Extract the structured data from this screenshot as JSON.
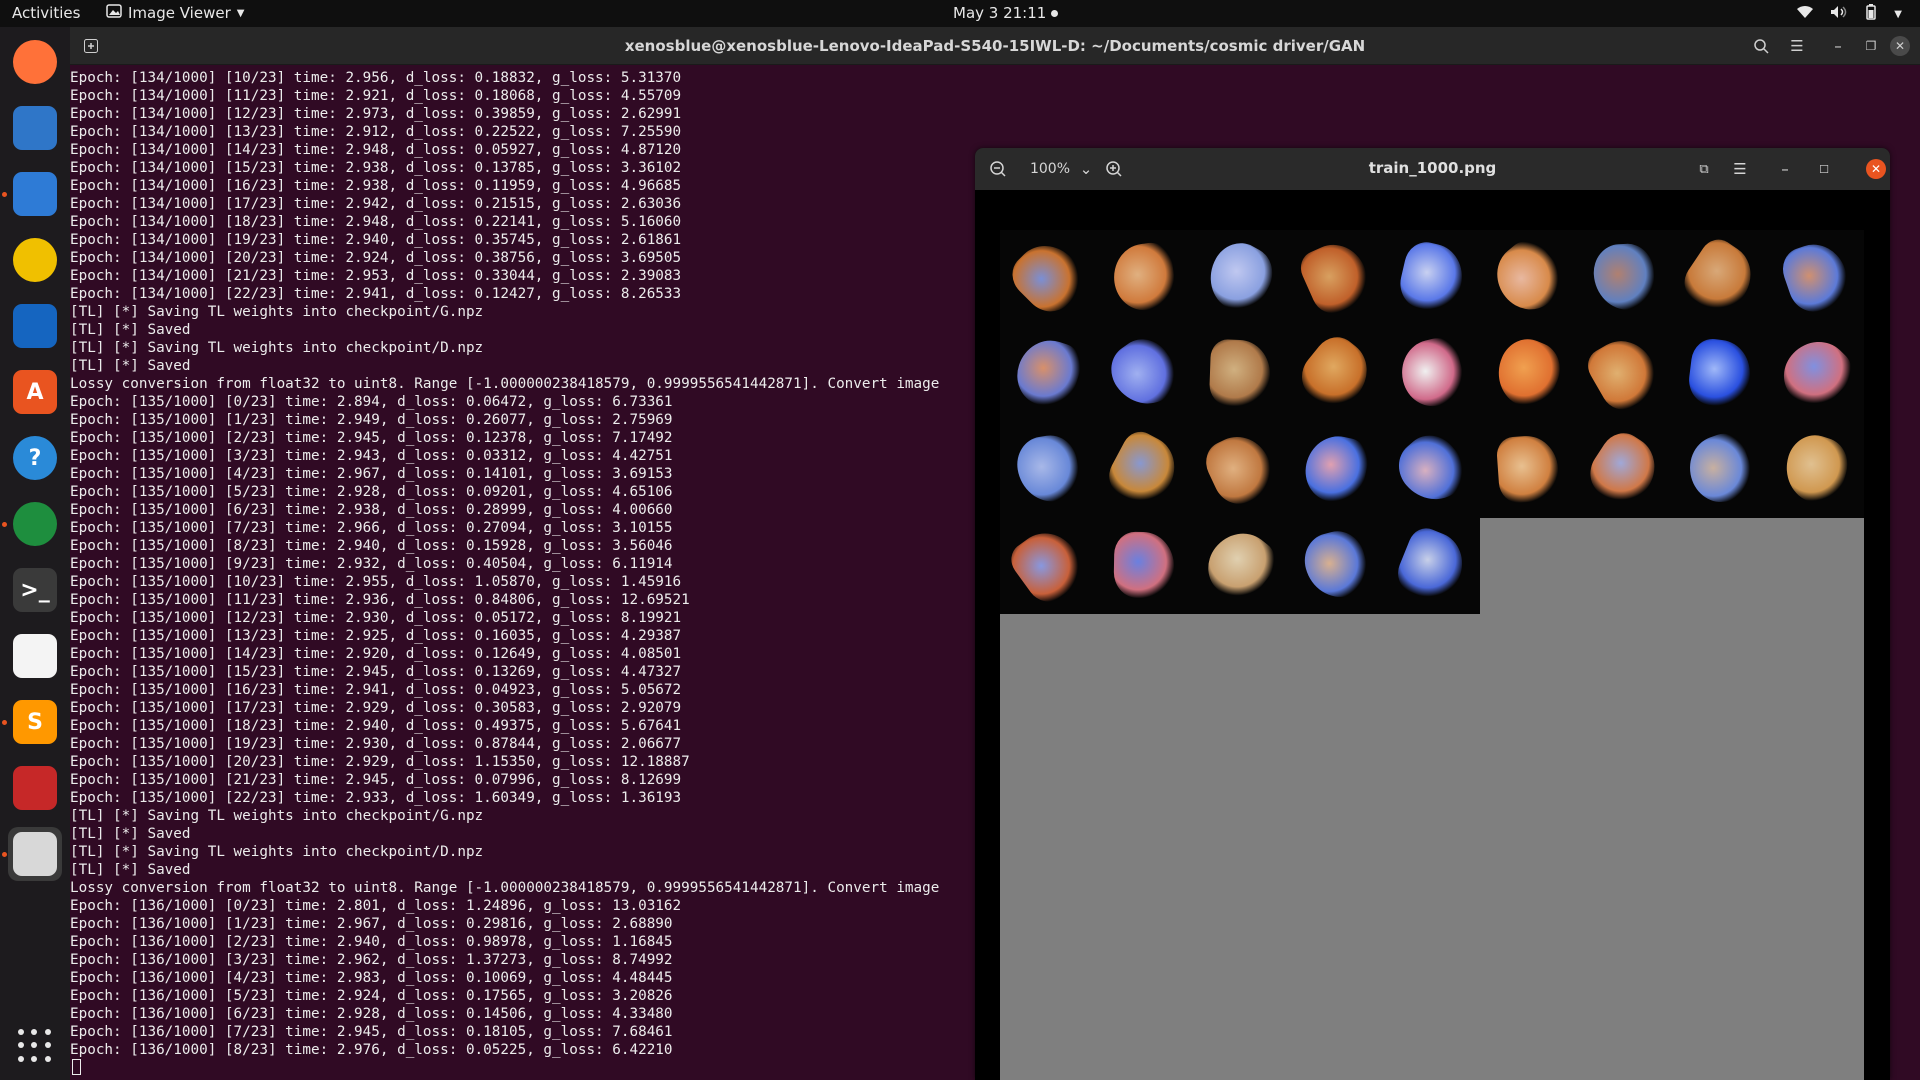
{
  "topbar": {
    "activities": "Activities",
    "app_name": "Image Viewer",
    "clock": "May 3  21:11"
  },
  "dock": {
    "items": [
      {
        "name": "firefox-icon",
        "glyph": "",
        "color": "#ff7139"
      },
      {
        "name": "thunderbird-icon",
        "glyph": "",
        "color": "#2f76c8"
      },
      {
        "name": "files-icon",
        "glyph": "",
        "color": "#2e7bd6"
      },
      {
        "name": "rhythmbox-icon",
        "glyph": "",
        "color": "#f0c000"
      },
      {
        "name": "writer-icon",
        "glyph": "",
        "color": "#1565c0"
      },
      {
        "name": "software-icon",
        "glyph": "A",
        "color": "#e95420"
      },
      {
        "name": "help-icon",
        "glyph": "?",
        "color": "#2a8ad8"
      },
      {
        "name": "chrome-icon",
        "glyph": "",
        "color": "#1e8e3e"
      },
      {
        "name": "terminal-icon",
        "glyph": ">_",
        "color": "#3a3a3a"
      },
      {
        "name": "text-editor-icon",
        "glyph": "",
        "color": "#f4f4f4"
      },
      {
        "name": "sublime-icon",
        "glyph": "S",
        "color": "#ff9800"
      },
      {
        "name": "mosaic-app-icon",
        "glyph": "",
        "color": "#c62828"
      },
      {
        "name": "image-viewer-icon",
        "glyph": "",
        "color": "#d8d8d8"
      }
    ],
    "apps_grid": "show-applications"
  },
  "terminal": {
    "title": "xenosblue@xenosblue-Lenovo-IdeaPad-S540-15IWL-D: ~/Documents/cosmic driver/GAN",
    "lines": [
      "Epoch: [134/1000] [10/23] time: 2.956, d_loss: 0.18832, g_loss: 5.31370",
      "Epoch: [134/1000] [11/23] time: 2.921, d_loss: 0.18068, g_loss: 4.55709",
      "Epoch: [134/1000] [12/23] time: 2.973, d_loss: 0.39859, g_loss: 2.62991",
      "Epoch: [134/1000] [13/23] time: 2.912, d_loss: 0.22522, g_loss: 7.25590",
      "Epoch: [134/1000] [14/23] time: 2.948, d_loss: 0.05927, g_loss: 4.87120",
      "Epoch: [134/1000] [15/23] time: 2.938, d_loss: 0.13785, g_loss: 3.36102",
      "Epoch: [134/1000] [16/23] time: 2.938, d_loss: 0.11959, g_loss: 4.96685",
      "Epoch: [134/1000] [17/23] time: 2.942, d_loss: 0.21515, g_loss: 2.63036",
      "Epoch: [134/1000] [18/23] time: 2.948, d_loss: 0.22141, g_loss: 5.16060",
      "Epoch: [134/1000] [19/23] time: 2.940, d_loss: 0.35745, g_loss: 2.61861",
      "Epoch: [134/1000] [20/23] time: 2.924, d_loss: 0.38756, g_loss: 3.69505",
      "Epoch: [134/1000] [21/23] time: 2.953, d_loss: 0.33044, g_loss: 2.39083",
      "Epoch: [134/1000] [22/23] time: 2.941, d_loss: 0.12427, g_loss: 8.26533",
      "[TL] [*] Saving TL weights into checkpoint/G.npz",
      "[TL] [*] Saved",
      "[TL] [*] Saving TL weights into checkpoint/D.npz",
      "[TL] [*] Saved",
      "Lossy conversion from float32 to uint8. Range [-1.000000238418579, 0.9999556541442871]. Convert image",
      "Epoch: [135/1000] [0/23] time: 2.894, d_loss: 0.06472, g_loss: 6.73361",
      "Epoch: [135/1000] [1/23] time: 2.949, d_loss: 0.26077, g_loss: 2.75969",
      "Epoch: [135/1000] [2/23] time: 2.945, d_loss: 0.12378, g_loss: 7.17492",
      "Epoch: [135/1000] [3/23] time: 2.943, d_loss: 0.03312, g_loss: 4.42751",
      "Epoch: [135/1000] [4/23] time: 2.967, d_loss: 0.14101, g_loss: 3.69153",
      "Epoch: [135/1000] [5/23] time: 2.928, d_loss: 0.09201, g_loss: 4.65106",
      "Epoch: [135/1000] [6/23] time: 2.938, d_loss: 0.28999, g_loss: 4.00660",
      "Epoch: [135/1000] [7/23] time: 2.966, d_loss: 0.27094, g_loss: 3.10155",
      "Epoch: [135/1000] [8/23] time: 2.940, d_loss: 0.15928, g_loss: 3.56046",
      "Epoch: [135/1000] [9/23] time: 2.932, d_loss: 0.40504, g_loss: 6.11914",
      "Epoch: [135/1000] [10/23] time: 2.955, d_loss: 1.05870, g_loss: 1.45916",
      "Epoch: [135/1000] [11/23] time: 2.936, d_loss: 0.84806, g_loss: 12.69521",
      "Epoch: [135/1000] [12/23] time: 2.930, d_loss: 0.05172, g_loss: 8.19921",
      "Epoch: [135/1000] [13/23] time: 2.925, d_loss: 0.16035, g_loss: 4.29387",
      "Epoch: [135/1000] [14/23] time: 2.920, d_loss: 0.12649, g_loss: 4.08501",
      "Epoch: [135/1000] [15/23] time: 2.945, d_loss: 0.13269, g_loss: 4.47327",
      "Epoch: [135/1000] [16/23] time: 2.941, d_loss: 0.04923, g_loss: 5.05672",
      "Epoch: [135/1000] [17/23] time: 2.929, d_loss: 0.30583, g_loss: 2.92079",
      "Epoch: [135/1000] [18/23] time: 2.940, d_loss: 0.49375, g_loss: 5.67641",
      "Epoch: [135/1000] [19/23] time: 2.930, d_loss: 0.87844, g_loss: 2.06677",
      "Epoch: [135/1000] [20/23] time: 2.929, d_loss: 1.15350, g_loss: 12.18887",
      "Epoch: [135/1000] [21/23] time: 2.945, d_loss: 0.07996, g_loss: 8.12699",
      "Epoch: [135/1000] [22/23] time: 2.933, d_loss: 1.60349, g_loss: 1.36193",
      "[TL] [*] Saving TL weights into checkpoint/G.npz",
      "[TL] [*] Saved",
      "[TL] [*] Saving TL weights into checkpoint/D.npz",
      "[TL] [*] Saved",
      "Lossy conversion from float32 to uint8. Range [-1.000000238418579, 0.9999556541442871]. Convert image",
      "Epoch: [136/1000] [0/23] time: 2.801, d_loss: 1.24896, g_loss: 13.03162",
      "Epoch: [136/1000] [1/23] time: 2.967, d_loss: 0.29816, g_loss: 2.68890",
      "Epoch: [136/1000] [2/23] time: 2.940, d_loss: 0.98978, g_loss: 1.16845",
      "Epoch: [136/1000] [3/23] time: 2.962, d_loss: 1.37273, g_loss: 8.74992",
      "Epoch: [136/1000] [4/23] time: 2.983, d_loss: 0.10069, g_loss: 4.48445",
      "Epoch: [136/1000] [5/23] time: 2.924, d_loss: 0.17565, g_loss: 3.20826",
      "Epoch: [136/1000] [6/23] time: 2.928, d_loss: 0.14506, g_loss: 4.33480",
      "Epoch: [136/1000] [7/23] time: 2.945, d_loss: 0.18105, g_loss: 7.68461",
      "Epoch: [136/1000] [8/23] time: 2.976, d_loss: 0.05225, g_loss: 6.42210"
    ]
  },
  "viewer": {
    "filename": "train_1000.png",
    "zoom": "100%",
    "tile_palettes": [
      [
        "#c9722f",
        "#7a8fd6"
      ],
      [
        "#d07a3c",
        "#e0b080"
      ],
      [
        "#8aa0e0",
        "#c0c8f0"
      ],
      [
        "#c0602a",
        "#d8a060"
      ],
      [
        "#5a78e8",
        "#c8d0f0"
      ],
      [
        "#d88a4a",
        "#e8b8a0"
      ],
      [
        "#6080c0",
        "#b08070"
      ],
      [
        "#c87a3a",
        "#d8a878"
      ],
      [
        "#5c7ad8",
        "#d09070"
      ],
      [
        "#6a7ad0",
        "#d8906a"
      ],
      [
        "#6070e0",
        "#a0b0f0"
      ],
      [
        "#b07a4a",
        "#d0b080"
      ],
      [
        "#c8702a",
        "#e0a860"
      ],
      [
        "#d06a8a",
        "#f0f0f0"
      ],
      [
        "#e07030",
        "#f0a050"
      ],
      [
        "#d07838",
        "#e0b070"
      ],
      [
        "#2a50e0",
        "#a0b8f8"
      ],
      [
        "#d07080",
        "#8090e0"
      ],
      [
        "#6888d8",
        "#a8b8e8"
      ],
      [
        "#c8883a",
        "#8898d0"
      ],
      [
        "#c07840",
        "#e0b080"
      ],
      [
        "#4a70e0",
        "#e0a0b0"
      ],
      [
        "#5070d8",
        "#d8b0c0"
      ],
      [
        "#d08040",
        "#e8c090"
      ],
      [
        "#d07848",
        "#a0a8d8"
      ],
      [
        "#6a88d8",
        "#c8b0a0"
      ],
      [
        "#d09850",
        "#e0c090"
      ],
      [
        "#c8603a",
        "#8898e0"
      ],
      [
        "#d07080",
        "#6a80e0"
      ],
      [
        "#c8a070",
        "#e0d0b0"
      ],
      [
        "#5a78d8",
        "#d8b090"
      ],
      [
        "#4a68d8",
        "#c8d0e8"
      ]
    ]
  }
}
